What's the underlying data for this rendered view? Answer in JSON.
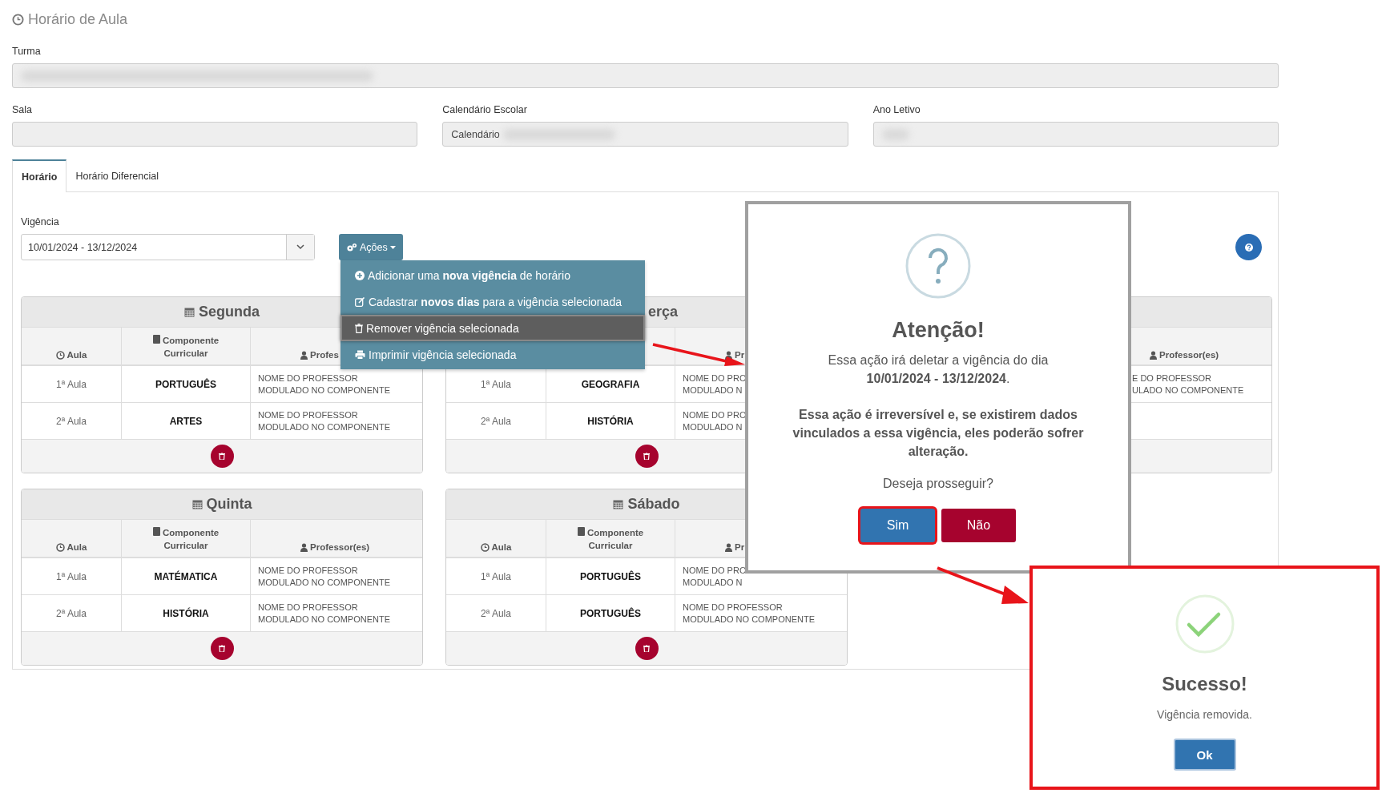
{
  "page": {
    "title": "Horário de Aula"
  },
  "form": {
    "turma": {
      "label": "Turma"
    },
    "sala": {
      "label": "Sala"
    },
    "calendario": {
      "label": "Calendário Escolar",
      "value": "Calendário"
    },
    "ano_letivo": {
      "label": "Ano Letivo"
    }
  },
  "tabs": [
    {
      "label": "Horário",
      "selected": true
    },
    {
      "label": "Horário Diferencial",
      "selected": false
    }
  ],
  "vigencia": {
    "label": "Vigência",
    "value": "10/01/2024 - 13/12/2024"
  },
  "actions_button": {
    "label": "Ações"
  },
  "actions_menu": [
    {
      "text": "Adicionar uma **nova vigência** de horário",
      "selected": false
    },
    {
      "text": "Cadastrar **novos dias** para a vigência selecionada",
      "selected": false
    },
    {
      "text": "Remover vigência selecionada",
      "selected": true
    },
    {
      "text": "Imprimir vigência selecionada",
      "selected": false
    }
  ],
  "days": [
    {
      "title": "Segunda",
      "header": {
        "aula": "Aula",
        "componente": "Componente Curricular",
        "professor": "Profes"
      },
      "rows": [
        {
          "aula": "1ª Aula",
          "componente": "PORTUGUÊS",
          "professor": [
            "NOME DO PROFESSOR",
            "MODULADO NO COMPONENTE"
          ]
        },
        {
          "aula": "2ª Aula",
          "componente": "ARTES",
          "professor": [
            "NOME DO PROFESSOR",
            "MODULADO NO COMPONENTE"
          ]
        }
      ],
      "delete_button": true
    },
    {
      "title": "erça",
      "header": {
        "professor": "Pr"
      },
      "rows": [
        {
          "aula": "1ª Aula",
          "componente": "GEOGRAFIA",
          "professor": [
            "NOME DO PRO",
            "MODULADO N"
          ]
        },
        {
          "aula": "2ª Aula",
          "componente": "HISTÓRIA",
          "professor": [
            "NOME DO PRO",
            "MODULADO N"
          ]
        }
      ],
      "delete_button": true
    },
    {
      "header": {
        "professor": "Professor(es)"
      },
      "rows": [
        {
          "professor": [
            "E DO PROFESSOR",
            "ULADO NO COMPONENTE"
          ]
        },
        {}
      ],
      "delete_button": false
    },
    {
      "title": "Quinta",
      "header": {
        "aula": "Aula",
        "componente": "Componente Curricular",
        "professor": "Professor(es)"
      },
      "rows": [
        {
          "aula": "1ª Aula",
          "componente": "MATÉMATICA",
          "professor": [
            "NOME DO PROFESSOR",
            "MODULADO NO COMPONENTE"
          ]
        },
        {
          "aula": "2ª Aula",
          "componente": "HISTÓRIA",
          "professor": [
            "NOME DO PROFESSOR",
            "MODULADO NO COMPONENTE"
          ]
        }
      ],
      "delete_button": true
    },
    {
      "title": "Sábado",
      "header": {
        "aula": "Aula",
        "componente": "Componente Curricular",
        "professor": "Pr"
      },
      "rows": [
        {
          "aula": "1ª Aula",
          "componente": "PORTUGUÊS",
          "professor": [
            "NOME DO PRO",
            "MODULADO N"
          ]
        },
        {
          "aula": "2ª Aula",
          "componente": "PORTUGUÊS",
          "professor": [
            "NOME DO PROFESSOR",
            "MODULADO NO COMPONENTE"
          ]
        }
      ],
      "delete_button": true
    }
  ],
  "confirm_dialog": {
    "title": "Atenção!",
    "message": "Essa ação irá deletar a vigência do dia **10/01/2024 - 13/12/2024**.",
    "warning": "Essa ação é irreversível e, se existirem dados vinculados a essa vigência, eles poderão sofrer alteração.",
    "question": "Deseja prosseguir?",
    "buttons": [
      {
        "label": "Sim",
        "kind": "confirm",
        "highlighted": true
      },
      {
        "label": "Não",
        "kind": "cancel",
        "highlighted": false
      }
    ]
  },
  "success_dialog": {
    "title": "Sucesso!",
    "message": "Vigência removida.",
    "button": "Ok",
    "highlighted": true
  }
}
